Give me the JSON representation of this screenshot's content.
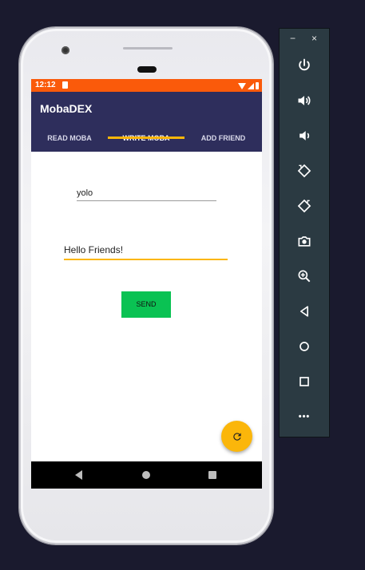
{
  "status_bar": {
    "time": "12:12"
  },
  "app": {
    "title": "MobaDEX"
  },
  "tabs": [
    {
      "label": "READ MOBA"
    },
    {
      "label": "WRITE MOBA"
    },
    {
      "label": "ADD FRIEND"
    }
  ],
  "active_tab": "WRITE MOBA",
  "form": {
    "name_value": "yolo",
    "message_value": "Hello Friends!",
    "send_label": "SEND"
  },
  "emulator_toolbar": {
    "minimize": "−",
    "close": "×",
    "more": "•••",
    "buttons": [
      "power-icon",
      "volume-up-icon",
      "volume-down-icon",
      "rotate-left-icon",
      "rotate-right-icon",
      "camera-icon",
      "zoom-icon",
      "back-icon",
      "home-icon",
      "overview-icon",
      "more-icon"
    ]
  },
  "colors": {
    "status_bar": "#fa5a0a",
    "app_bar": "#2e2e5c",
    "accent": "#fbb60a",
    "send_button": "#0ac253",
    "toolbar": "#2b3a42",
    "background": "#1a1a2e"
  }
}
